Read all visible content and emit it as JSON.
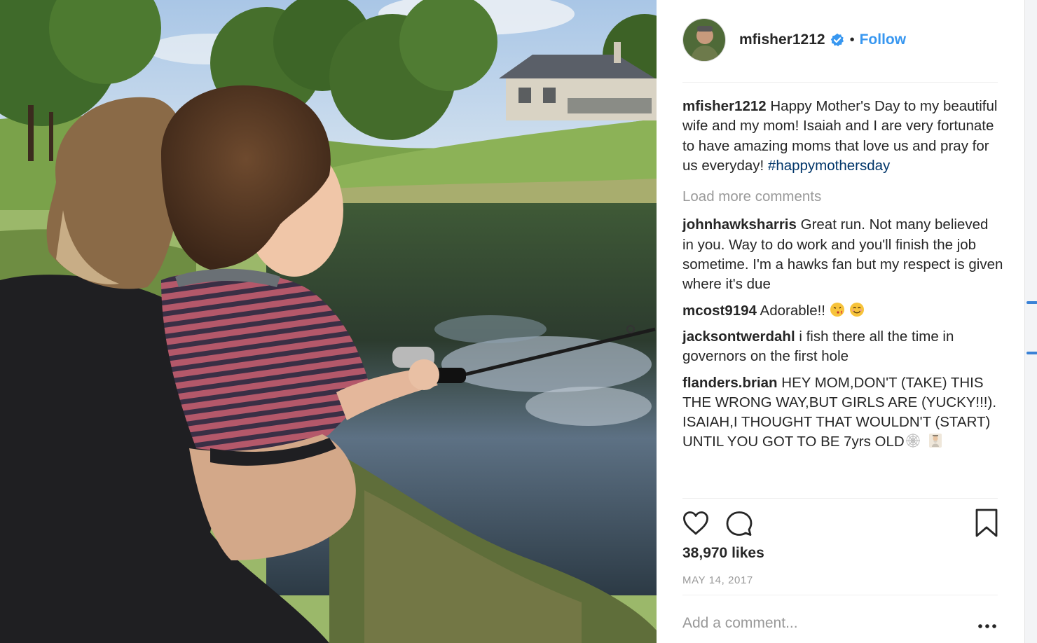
{
  "post": {
    "username": "mfisher1212",
    "follow_label": "Follow",
    "separator": "•"
  },
  "caption": {
    "user": "mfisher1212",
    "text": " Happy Mother's Day to my beautiful wife and my mom! Isaiah and I are very fortunate to have amazing moms that love us and pray for us everyday! ",
    "hashtag": "#happymothersday"
  },
  "load_more_label": "Load more comments",
  "comments": [
    {
      "user": "johnhawksharris",
      "text": " Great run. Not many believed in you. Way to do work and you'll finish the job sometime. I'm a hawks fan but my respect is given where it's due"
    },
    {
      "user": "mcost9194",
      "text": " Adorable!!",
      "emojis": [
        "kissing-face-emoji",
        "smiling-face-emoji"
      ]
    },
    {
      "user": "jacksontwerdahl",
      "text": " i fish there all the time in governors on the first hole"
    },
    {
      "user": "flanders.brian",
      "text": " HEY MOM,DON'T (TAKE) THIS THE WRONG WAY,BUT GIRLS ARE (YUCKY!!!). ISAIAH,I THOUGHT THAT WOULDN'T (START) UNTIL YOU GOT TO BE 7yrs OLD",
      "emojis": [
        "spider-web-emoji",
        "mage-emoji"
      ]
    }
  ],
  "likes": "38,970 likes",
  "date": "MAY 14, 2017",
  "add_comment_placeholder": "Add a comment...",
  "icons": [
    "heart-icon",
    "comment-icon",
    "bookmark-icon",
    "more-options-icon",
    "verified-badge-icon"
  ],
  "colors": {
    "link_blue": "#3897f0",
    "hashtag_blue": "#003569",
    "muted_gray": "#999999",
    "text": "#262626"
  }
}
